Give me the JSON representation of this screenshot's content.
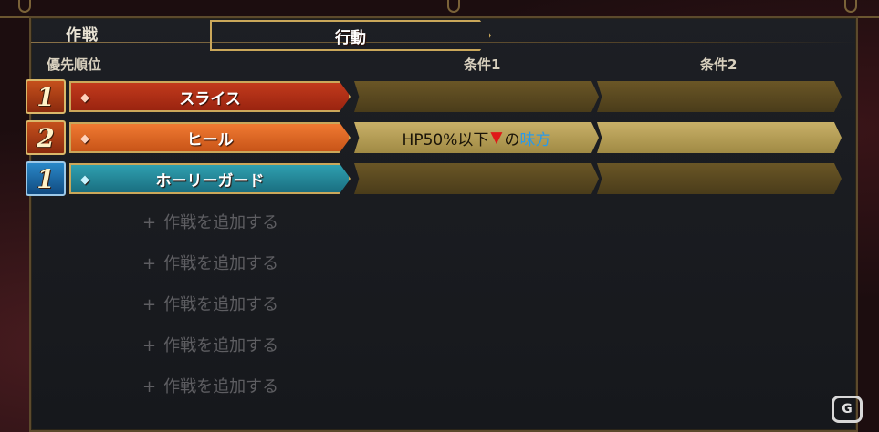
{
  "panel": {
    "title": "作戦"
  },
  "headers": {
    "priority": "優先順位",
    "action": "行動",
    "condition1": "条件1",
    "condition2": "条件2"
  },
  "rows": [
    {
      "priority": "1",
      "priority_color": "red",
      "action": "スライス",
      "action_color": "#c23a1c",
      "condition1": "",
      "condition2": ""
    },
    {
      "priority": "2",
      "priority_color": "red",
      "action": "ヒール",
      "action_color": "#f07a32",
      "condition1_parts": {
        "hp": "HP50%以下",
        "arrow": "▼",
        "particle": "の",
        "target": "味方"
      },
      "condition2": ""
    },
    {
      "priority": "1",
      "priority_color": "blue",
      "action": "ホーリーガード",
      "action_color": "#2fa0b0",
      "condition1": "",
      "condition2": ""
    }
  ],
  "add_items": [
    {
      "plus": "+",
      "label": "作戦を追加する"
    },
    {
      "plus": "+",
      "label": "作戦を追加する"
    },
    {
      "plus": "+",
      "label": "作戦を追加する"
    },
    {
      "plus": "+",
      "label": "作戦を追加する"
    },
    {
      "plus": "+",
      "label": "作戦を追加する"
    }
  ],
  "icons": {
    "gem": "◆"
  },
  "watermark": "G"
}
